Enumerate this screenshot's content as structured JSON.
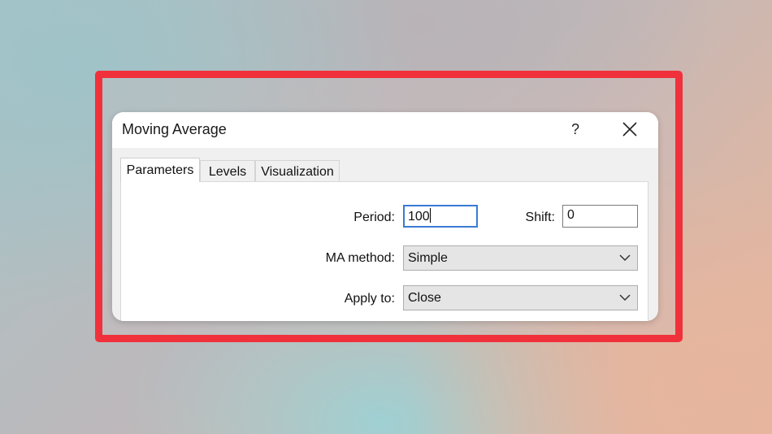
{
  "dialog": {
    "title": "Moving Average",
    "help_label": "?"
  },
  "tabs": [
    {
      "label": "Parameters",
      "active": true
    },
    {
      "label": "Levels",
      "active": false
    },
    {
      "label": "Visualization",
      "active": false
    }
  ],
  "parameters": {
    "period_label": "Period:",
    "period_value": "100",
    "shift_label": "Shift:",
    "shift_value": "0",
    "ma_method_label": "MA method:",
    "ma_method_value": "Simple",
    "apply_to_label": "Apply to:",
    "apply_to_value": "Close"
  },
  "colors": {
    "highlight_border": "#f0313b",
    "focus_border": "#3a7bd5"
  },
  "icons": {
    "close": "close-icon",
    "dropdown": "chevron-down-icon"
  }
}
